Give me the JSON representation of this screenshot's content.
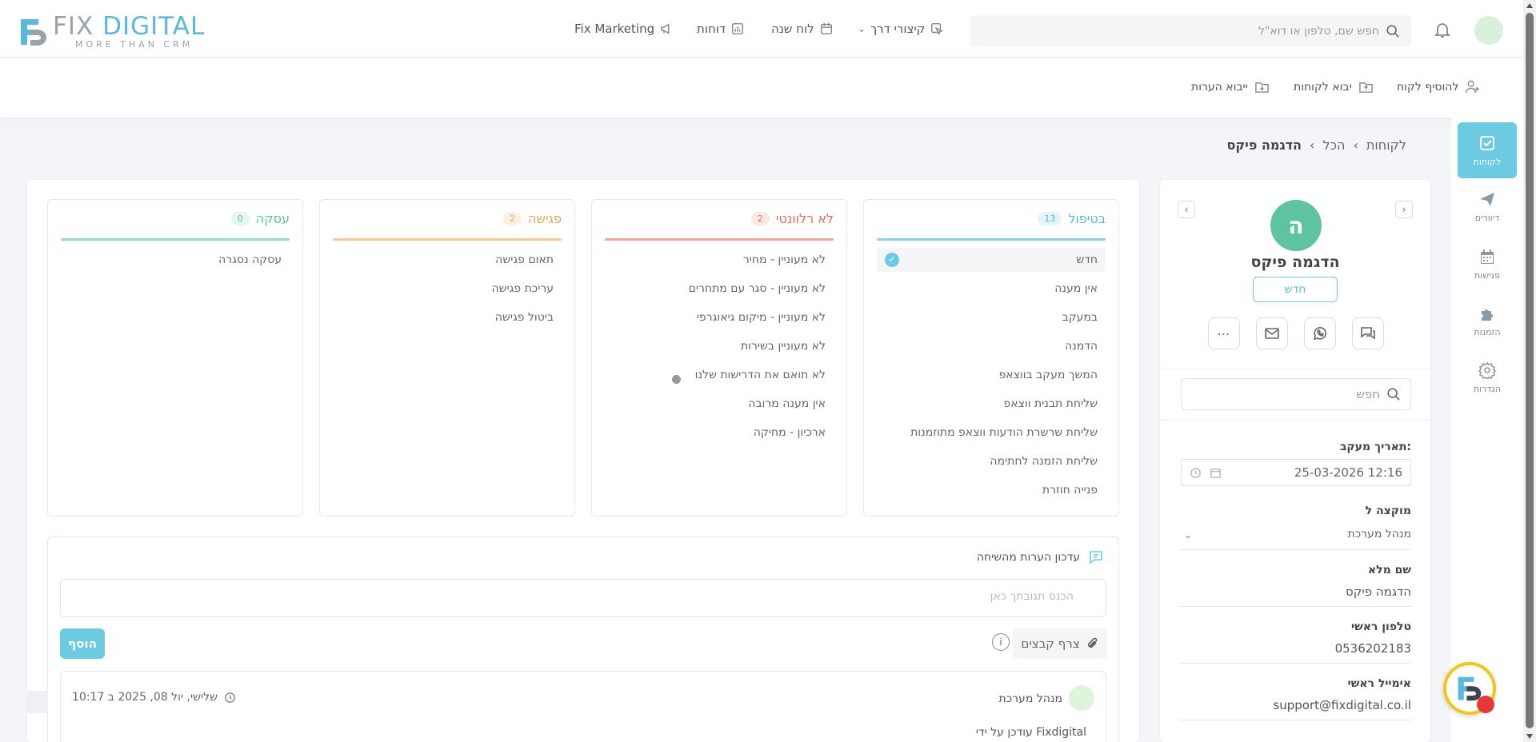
{
  "header": {
    "logo": {
      "brand_left": "FIX",
      "brand_right": "DIGITAL",
      "tagline": "MORE THAN CRM"
    },
    "search_placeholder": "חפש שם, טלפון או דוא\"ל",
    "nav": [
      {
        "label": "קיצורי דרך",
        "icon": "shortcut-icon"
      },
      {
        "label": "לוח שנה",
        "icon": "calendar-icon"
      },
      {
        "label": "דוחות",
        "icon": "chart-icon"
      },
      {
        "label": "Fix Marketing",
        "icon": "megaphone-icon"
      }
    ]
  },
  "toolbar": {
    "add_customer": "להוסיף לקוח",
    "import_customers": "יבוא לקוחות",
    "import_notes": "ייבוא הערות"
  },
  "rail": [
    {
      "label": "לקוחות",
      "icon": "checkbox-icon",
      "active": true
    },
    {
      "label": "דיוורים",
      "icon": "send-icon"
    },
    {
      "label": "פגישות",
      "icon": "calendar-icon"
    },
    {
      "label": "הזמנות",
      "icon": "puzzle-icon"
    },
    {
      "label": "הגדרות",
      "icon": "gear-icon"
    }
  ],
  "breadcrumb": {
    "root": "לקוחות",
    "mid": "הכל",
    "current": "הדגמה פיקס",
    "sep": "›"
  },
  "contact": {
    "avatar_letter": "ה",
    "name": "הדגמה פיקס",
    "status": "חדש",
    "search_placeholder": "חפש",
    "fields": {
      "followup_label": "תאריך מעקב:",
      "followup_value": "25-03-2026 12:16",
      "assigned_label": "מוקצה ל",
      "assigned_value": "מנהל מערכת",
      "fullname_label": "שם מלא",
      "fullname_value": "הדגמה פיקס",
      "phone_label": "טלפון ראשי",
      "phone_value": "0536202183",
      "email_label": "אימייל ראשי",
      "email_value": "support@fixdigital.co.il"
    }
  },
  "pipeline": {
    "columns": [
      {
        "title": "בטיפול",
        "count": "13",
        "color": "#5ab8d9",
        "badge_bg": "#e5f4fa",
        "items": [
          "חדש",
          "אין מענה",
          "במעקב",
          "הדמנה",
          "המשך מעקב בווצאפ",
          "שליחת תבנית ווצאפ",
          "שליחת שרשרת הודעות ווצאפ מתוזמנות",
          "שליחת הזמנה לחתימה",
          "פנייה חוזרת"
        ]
      },
      {
        "title": "לא רלוונטי",
        "count": "2",
        "color": "#e86c5a",
        "badge_bg": "#fbe9e6",
        "items": [
          "לא מעוניין - מחיר",
          "לא מעוניין - סגר עם מתחרים",
          "לא מעוניין - מיקום גיאוגרפי",
          "לא מעוניין בשירות",
          "לא תואם את הדרישות שלנו",
          "אין מענה מרובה",
          "ארכיון - מחיקה"
        ]
      },
      {
        "title": "פגישה",
        "count": "2",
        "color": "#f0a35a",
        "badge_bg": "#fdf0e3",
        "items": [
          "תאום פגישה",
          "עריכת פגישה",
          "ביטול פגישה"
        ]
      },
      {
        "title": "עסקה",
        "count": "0",
        "color": "#5ec4a0",
        "badge_bg": "#e4f6ef",
        "items": [
          "עסקה נסגרה"
        ]
      }
    ]
  },
  "notes": {
    "title": "עדכון הערות מהשיחה",
    "placeholder": "הכנס תגובתך כאן",
    "attach": "צרף קבצים",
    "add": "הוסף",
    "entry": {
      "author": "מנהל מערכת",
      "timestamp": "שלישי, יול 08, 2025 ב 10:17",
      "updated_by": "עודכן על ידי Fixdigital"
    }
  }
}
